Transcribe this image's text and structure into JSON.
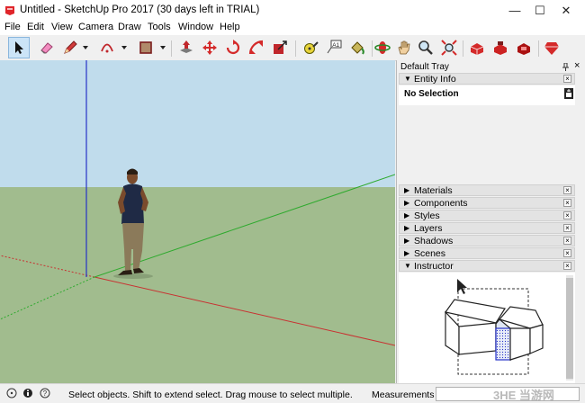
{
  "window": {
    "title": "Untitled - SketchUp Pro 2017 (30 days left in TRIAL)",
    "minimize": "—",
    "maximize": "☐",
    "close": "✕"
  },
  "menu": [
    "File",
    "Edit",
    "View",
    "Camera",
    "Draw",
    "Tools",
    "Window",
    "Help"
  ],
  "toolbar": {
    "tools": [
      "select",
      "eraser",
      "pencil-line",
      "arc",
      "shape",
      "push-pull",
      "move",
      "rotate",
      "scale",
      "tape-measure",
      "text",
      "paint-bucket",
      "orbit",
      "pan",
      "zoom",
      "zoom-extents",
      "3d-warehouse",
      "extension-warehouse",
      "component-share",
      "extension-manager"
    ],
    "active_tool": "select"
  },
  "tray": {
    "title": "Default Tray",
    "pin": "pin-icon",
    "close": "×",
    "entity_info": {
      "label": "Entity Info",
      "selection": "No Selection"
    },
    "panels": [
      "Materials",
      "Components",
      "Styles",
      "Layers",
      "Shadows",
      "Scenes",
      "Instructor"
    ],
    "panel_close": "×"
  },
  "status": {
    "message": "Select objects. Shift to extend select. Drag mouse to select multiple.",
    "measurements_label": "Measurements",
    "measurements_value": ""
  },
  "watermark": "3HE 当游网",
  "colors": {
    "ground": "#a1bc8e",
    "sky": "#c0dcec",
    "x_axis": "#c83232",
    "y_axis": "#2eaa2e",
    "z_axis": "#2632c8",
    "accent": "#cce4f7"
  }
}
